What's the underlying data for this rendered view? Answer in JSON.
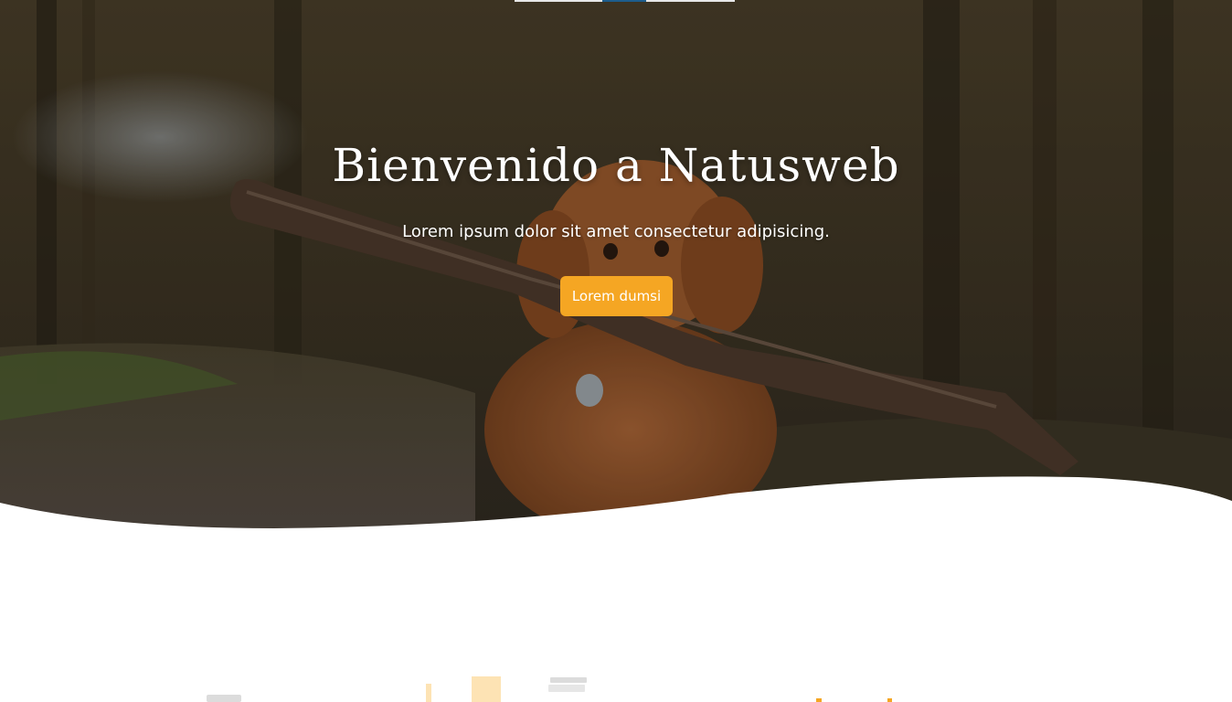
{
  "nav": {
    "active_index": 2
  },
  "hero": {
    "title": "Bienvenido a Natusweb",
    "subtitle": "Lorem ipsum dolor sit amet consectetur adipisicing.",
    "button_label": "Lorem dumsi",
    "image_description": "dog-with-stick-photo"
  },
  "colors": {
    "accent": "#f5a623",
    "nav_active": "#1d5d8c",
    "text_light": "#ffffff",
    "deco_light": "#fde3b4",
    "deco_grey": "#dcdcdc"
  },
  "icons": {
    "below_left": "illustration-fragment",
    "below_right": "illustration-fragment"
  }
}
